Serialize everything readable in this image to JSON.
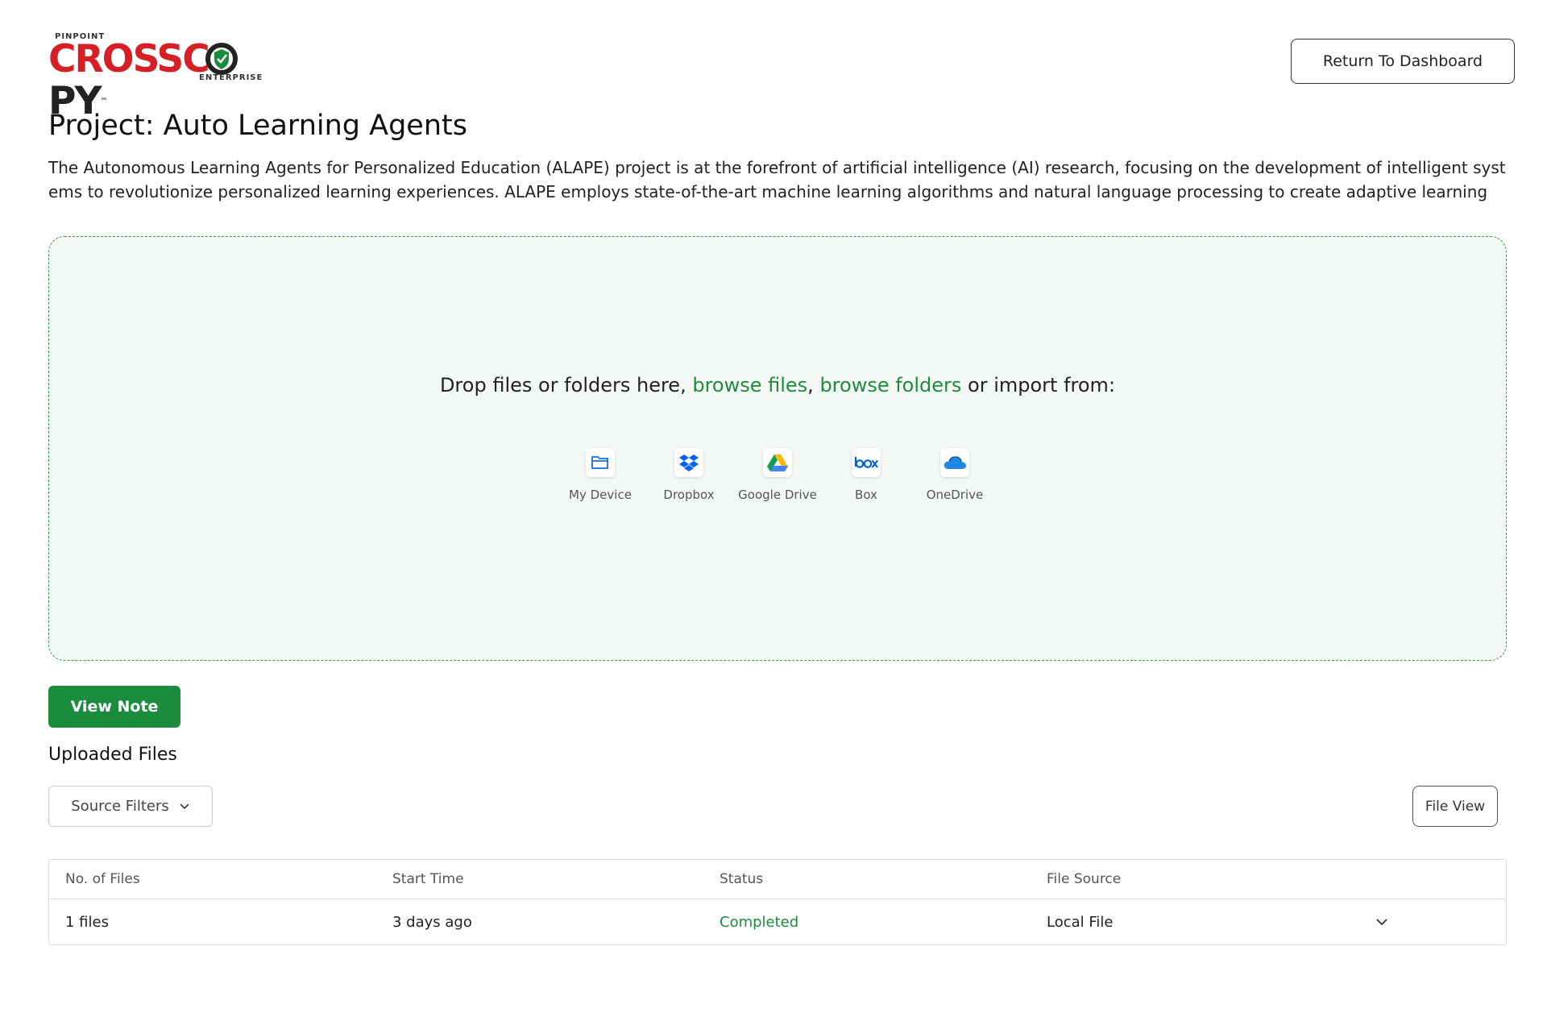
{
  "header": {
    "logo_top": "PINPOINT",
    "logo_main_red": "CROSSC",
    "logo_main_dark": "PY",
    "logo_sub": "ENTERPRISE",
    "logo_tm": "™",
    "return_label": "Return To Dashboard"
  },
  "project": {
    "title": "Project: Auto Learning Agents",
    "description": "The Autonomous Learning Agents for Personalized Education (ALAPE) project is at the forefront of artificial intelligence (AI) research, focusing on the development of intelligent systems to revolutionize personalized learning experiences. ALAPE employs state-of-the-art machine learning algorithms and natural language processing to create adaptive learning ..."
  },
  "dropzone": {
    "text_prefix": "Drop files or folders here, ",
    "browse_files": "browse files",
    "separator": ", ",
    "browse_folders": "browse folders",
    "text_suffix": " or import from:",
    "sources": [
      {
        "label": "My Device",
        "icon": "folder-icon"
      },
      {
        "label": "Dropbox",
        "icon": "dropbox-icon"
      },
      {
        "label": "Google Drive",
        "icon": "google-drive-icon"
      },
      {
        "label": "Box",
        "icon": "box-icon"
      },
      {
        "label": "OneDrive",
        "icon": "onedrive-icon"
      }
    ]
  },
  "actions": {
    "view_note": "View Note"
  },
  "uploads": {
    "heading": "Uploaded Files",
    "filters_label": "Source Filters",
    "file_view_label": "File View",
    "columns": [
      "No. of Files",
      "Start Time",
      "Status",
      "File Source"
    ],
    "rows": [
      {
        "files": "1 files",
        "start": "3 days ago",
        "status": "Completed",
        "source": "Local File"
      }
    ]
  },
  "colors": {
    "accent": "#1b8c3d",
    "link": "#1e8c3c",
    "brand_red": "#d62027"
  }
}
